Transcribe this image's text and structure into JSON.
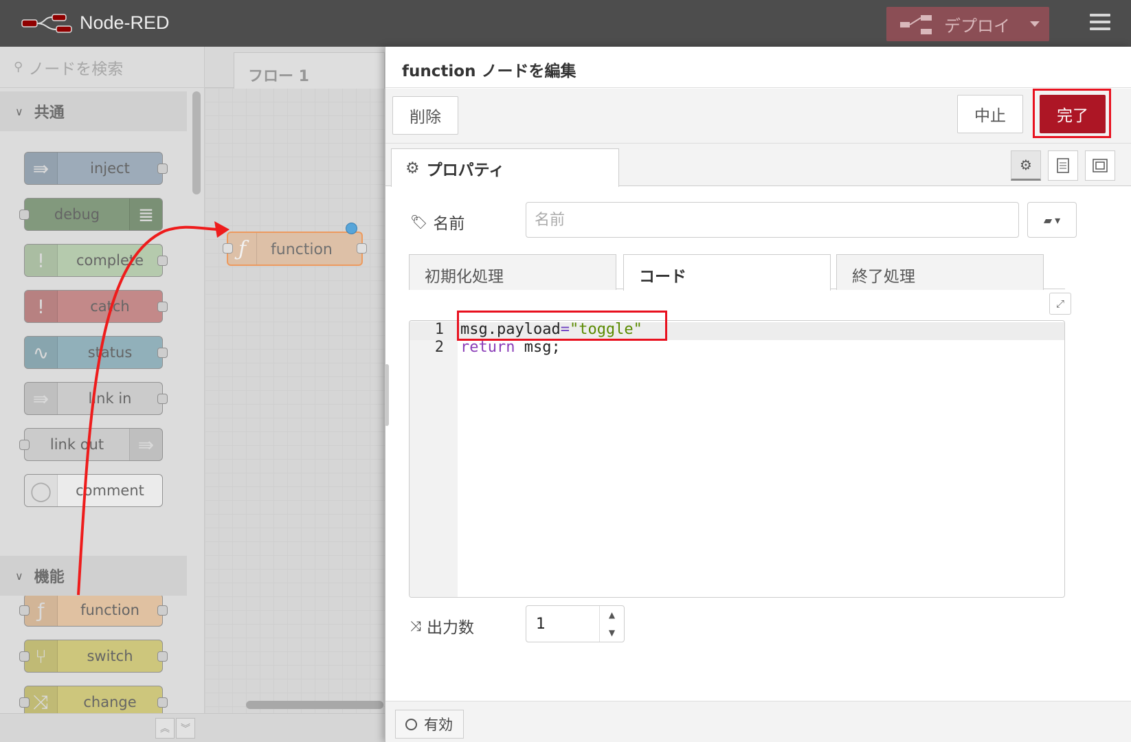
{
  "header": {
    "app_title": "Node-RED",
    "deploy_label": "デプロイ",
    "logo_icon": "node-red-logo-icon",
    "menu_icon": "hamburger-icon"
  },
  "palette": {
    "search_placeholder": "ノードを検索",
    "categories": [
      {
        "label": "共通"
      },
      {
        "label": "機能"
      }
    ],
    "nodes": [
      {
        "label": "inject",
        "color": "#a6bbcf",
        "icon": "inject-arrow-icon"
      },
      {
        "label": "debug",
        "color": "#87a980",
        "icon": "debug-list-icon"
      },
      {
        "label": "complete",
        "color": "#c0deb4",
        "icon": "exclamation-icon"
      },
      {
        "label": "catch",
        "color": "#e49191",
        "icon": "exclamation-icon"
      },
      {
        "label": "status",
        "color": "#94c1d0",
        "icon": "pulse-icon"
      },
      {
        "label": "link in",
        "color": "#dddddd",
        "icon": "link-in-icon"
      },
      {
        "label": "link out",
        "color": "#dddddd",
        "icon": "link-out-icon"
      },
      {
        "label": "comment",
        "color": "#ffffff",
        "icon": "comment-bubble-icon"
      },
      {
        "label": "function",
        "color": "#fdd0a2",
        "icon": "function-f-icon"
      },
      {
        "label": "switch",
        "color": "#e2d96e",
        "icon": "switch-icon"
      },
      {
        "label": "change",
        "color": "#e2d96e",
        "icon": "shuffle-icon"
      }
    ]
  },
  "workspace": {
    "tab_label": "フロー 1",
    "node_label": "function",
    "node_color": "#fdd0a2"
  },
  "editor": {
    "title": "function ノードを編集",
    "delete_label": "削除",
    "cancel_label": "中止",
    "done_label": "完了",
    "properties_tab": "プロパティ",
    "name_label": "名前",
    "name_placeholder": "名前",
    "code_tabs": [
      "初期化処理",
      "コード",
      "終了処理"
    ],
    "code_lines": [
      {
        "n": "1",
        "parts": [
          "msg.payload",
          "=",
          "\"toggle\""
        ]
      },
      {
        "n": "2",
        "parts": [
          "return",
          " msg;"
        ]
      }
    ],
    "outputs_label": "出力数",
    "outputs_value": "1",
    "enabled_label": "有効",
    "accent_color": "#ad1625",
    "highlight_color": "#e8101e"
  }
}
